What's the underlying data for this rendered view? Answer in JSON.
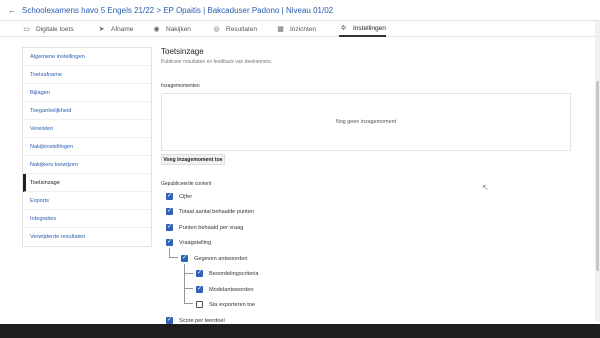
{
  "header": {
    "back_glyph": "←",
    "breadcrumb": "Schoolexamens havo 5 Engels 21/22 > EP Opaitis | Bakcaduser Padono | Niveau 01/02"
  },
  "tabs": [
    {
      "icon": "document-icon",
      "glyph": "▭",
      "label": "Digitale toets",
      "active": false
    },
    {
      "icon": "send-icon",
      "glyph": "➤",
      "label": "Afname",
      "active": false
    },
    {
      "icon": "eye-icon",
      "glyph": "◉",
      "label": "Nakijken",
      "active": false
    },
    {
      "icon": "results-icon",
      "glyph": "◎",
      "label": "Resultaten",
      "active": false
    },
    {
      "icon": "insights-icon",
      "glyph": "▦",
      "label": "Inzichten",
      "active": false
    },
    {
      "icon": "gear-icon",
      "glyph": "✲",
      "label": "Instellingen",
      "active": true
    }
  ],
  "sidebar": {
    "items": [
      {
        "label": "Algemene instellingen",
        "active": false
      },
      {
        "label": "Toetsafname",
        "active": false
      },
      {
        "label": "Bijlagen",
        "active": false
      },
      {
        "label": "Toegankelijkheid",
        "active": false
      },
      {
        "label": "Vereisten",
        "active": false
      },
      {
        "label": "Nakijkinstellingen",
        "active": false
      },
      {
        "label": "Nakijkers toewijzen",
        "active": false
      },
      {
        "label": "Toetsinzage",
        "active": true
      },
      {
        "label": "Exports",
        "active": false
      },
      {
        "label": "Integraties",
        "active": false
      },
      {
        "label": "Verwijderde resultaten",
        "active": false
      }
    ]
  },
  "main": {
    "title": "Toetsinzage",
    "subtitle": "Publiceer resultaten en feedback van deelnemers.",
    "inzage_label": "Inzagemomenten",
    "empty_text": "Nog geen inzagemoment",
    "add_button": "Voeg inzagemoment toe",
    "published_label": "Gepubliceerde content",
    "checkboxes": [
      {
        "label": "Cijfer",
        "checked": true
      },
      {
        "label": "Totaal aantal behaalde punten",
        "checked": true
      },
      {
        "label": "Punten behaald per vraag",
        "checked": true
      },
      {
        "label": "Vraagstelling",
        "checked": true
      },
      {
        "label": "Gegeven antwoorden",
        "checked": true
      },
      {
        "label": "Beoordelingscriteria",
        "checked": true
      },
      {
        "label": "Modelantwoorden",
        "checked": true
      },
      {
        "label": "Sta exporteren toe",
        "checked": false
      },
      {
        "label": "Score per leerdoel",
        "checked": true
      }
    ]
  },
  "colors": {
    "accent": "#2f63b8",
    "link": "#2a5db0"
  }
}
